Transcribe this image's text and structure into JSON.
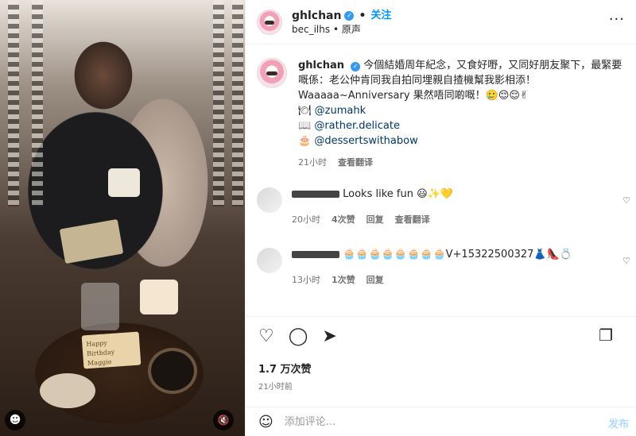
{
  "photo": {
    "card_text": "Happy Birthday Maggie",
    "user_tag_icon": "person-icon",
    "mute_icon": "muted-speaker-icon"
  },
  "header": {
    "username": "ghlchan",
    "follow_label": "关注",
    "audio_user": "bec_ilhs",
    "audio_label": "原声",
    "more_label": "···"
  },
  "caption": {
    "username": "ghlchan",
    "text": "今個結婚周年紀念，又食好嘢，又同好朋友聚下，最緊要嘅係：老公仲肯同我自拍同埋親自揸機幫我影相添！Waaaaa~Anniversary 果然唔同啲嘅！🥲😌😌✌",
    "mentions": [
      {
        "emoji": "🍽",
        "handle": "@zumahk"
      },
      {
        "emoji": "📖",
        "handle": "@rather.delicate"
      },
      {
        "emoji": "🎂",
        "handle": "@dessertswithabow"
      }
    ],
    "time": "21小时",
    "translate": "查看翻译"
  },
  "comments": [
    {
      "text": "Looks like fun 😃✨💛",
      "time": "20小时",
      "likes": "4次赞",
      "reply": "回复",
      "translate": "查看翻译"
    },
    {
      "text": "🧁🧁🧁🧁🧁🧁🧁🧁V+15322500327👗👠💍",
      "time": "13小时",
      "likes": "1次赞",
      "reply": "回复"
    }
  ],
  "actions": {
    "like_icon": "heart-icon",
    "comment_icon": "comment-icon",
    "share_icon": "send-icon",
    "save_icon": "bookmark-icon"
  },
  "likes": "1.7 万次赞",
  "post_time": "21小时前",
  "comment_box": {
    "placeholder": "添加评论...",
    "post_label": "发布"
  },
  "colors": {
    "accent": "#0095f6",
    "muted": "#737373"
  }
}
